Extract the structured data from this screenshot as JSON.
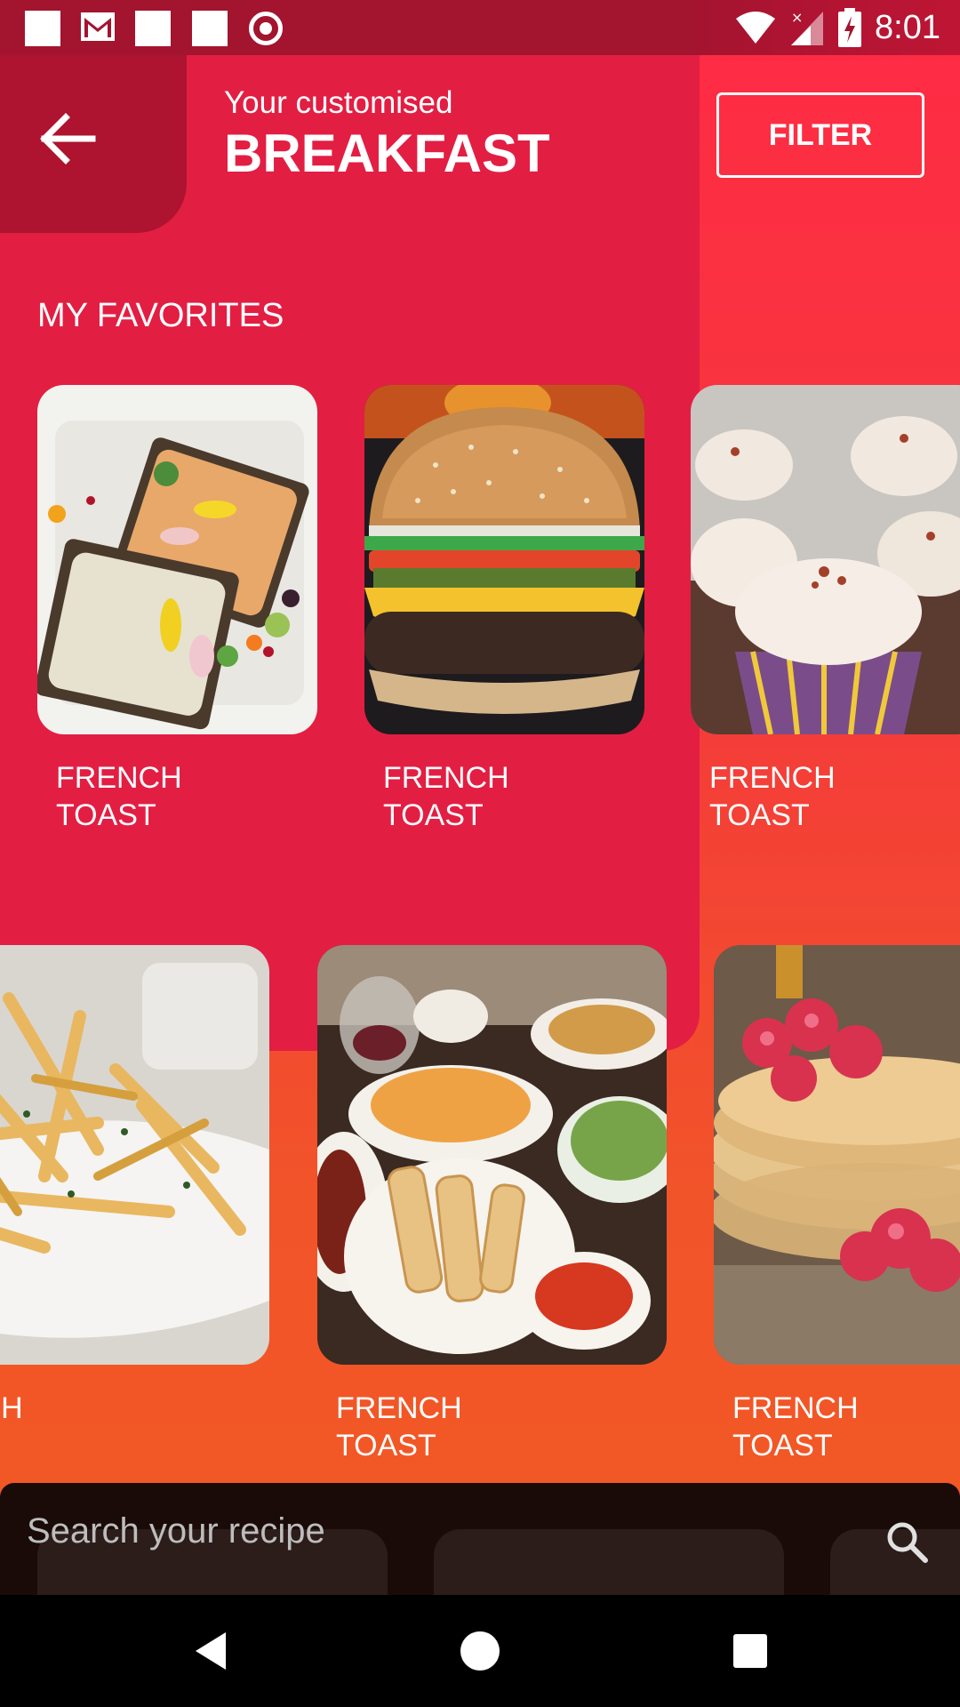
{
  "status_bar": {
    "time": "8:01"
  },
  "header": {
    "subtitle": "Your customised",
    "title": "BREAKFAST",
    "filter_label": "FILTER"
  },
  "favorites": {
    "title": "MY FAVORITES",
    "items": [
      {
        "label": "FRENCH\nTOAST",
        "image": "toast-with-spread"
      },
      {
        "label": "FRENCH\nTOAST",
        "image": "burger"
      },
      {
        "label": "FRENCH\nTOAST",
        "image": "cupcakes"
      }
    ]
  },
  "recipes": {
    "items": [
      {
        "label": "NCH\nST",
        "image": "fries"
      },
      {
        "label": "FRENCH\nTOAST",
        "image": "spring-rolls-platter"
      },
      {
        "label": "FRENCH\nTOAST",
        "image": "pancakes-raspberries"
      }
    ]
  },
  "search": {
    "placeholder": "Search your recipe"
  },
  "colors": {
    "panel": "#e31e43",
    "back_tab": "#ae132f",
    "status_bar": "#a3142f",
    "background_bottom": "#f15a22"
  }
}
